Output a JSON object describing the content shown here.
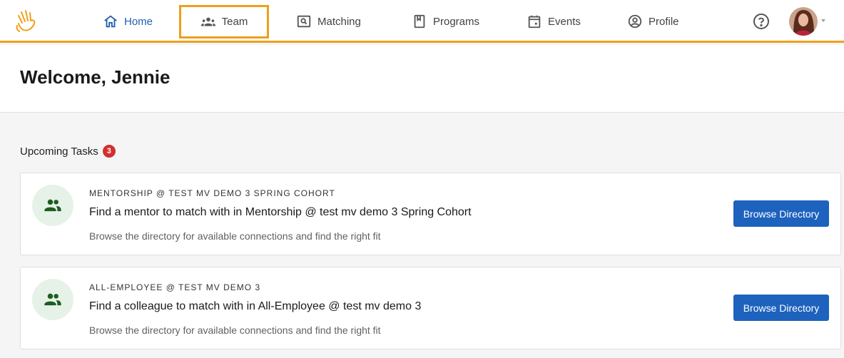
{
  "nav": {
    "logo_icon": "waving-hand-icon",
    "items": [
      {
        "label": "Home",
        "icon": "home-icon"
      },
      {
        "label": "Team",
        "icon": "team-icon"
      },
      {
        "label": "Matching",
        "icon": "matching-icon"
      },
      {
        "label": "Programs",
        "icon": "bookmark-icon"
      },
      {
        "label": "Events",
        "icon": "calendar-icon"
      },
      {
        "label": "Profile",
        "icon": "account-circle-icon"
      }
    ],
    "active": "Home",
    "highlighted": "Team",
    "accent_color": "#ef9f1c",
    "active_color": "#1f5fad"
  },
  "welcome": {
    "title": "Welcome, Jennie"
  },
  "tasks": {
    "title": "Upcoming Tasks",
    "count": "3",
    "items": [
      {
        "eyebrow": "MENTORSHIP @ TEST MV DEMO 3 SPRING COHORT",
        "title": "Find a mentor to match with in Mentorship @ test mv demo 3 Spring Cohort",
        "description": "Browse the directory for available connections and find the right fit",
        "button": "Browse Directory",
        "icon": "people-icon"
      },
      {
        "eyebrow": "ALL-EMPLOYEE @ TEST MV DEMO 3",
        "title": "Find a colleague to match with in All-Employee @ test mv demo 3",
        "description": "Browse the directory for available connections and find the right fit",
        "button": "Browse Directory",
        "icon": "people-icon"
      }
    ]
  }
}
